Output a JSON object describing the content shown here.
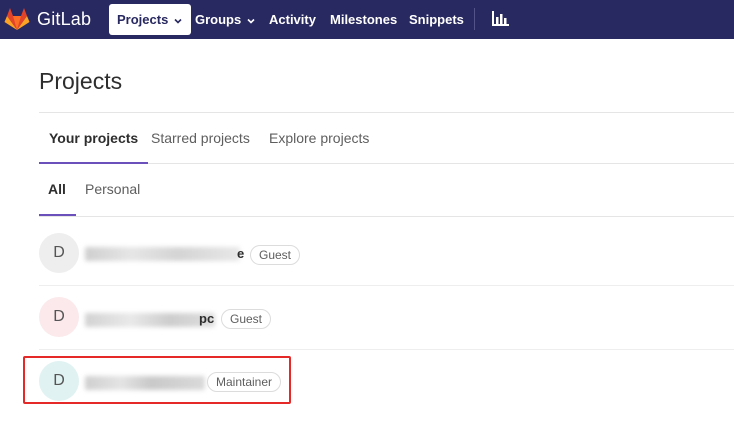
{
  "navbar": {
    "brand": "GitLab",
    "logo_icon": "gitlab-tanuki-icon",
    "items": [
      {
        "label": "Projects",
        "active": true,
        "has_dropdown": true
      },
      {
        "label": "Groups",
        "active": false,
        "has_dropdown": true
      },
      {
        "label": "Activity",
        "active": false,
        "has_dropdown": false
      },
      {
        "label": "Milestones",
        "active": false,
        "has_dropdown": false
      },
      {
        "label": "Snippets",
        "active": false,
        "has_dropdown": false
      }
    ],
    "extra_icon": "chart-bar-icon",
    "background": "#292961"
  },
  "page": {
    "title": "Projects"
  },
  "tabs": [
    {
      "label": "Your projects",
      "active": true
    },
    {
      "label": "Starred projects",
      "active": false
    },
    {
      "label": "Explore projects",
      "active": false
    }
  ],
  "subtabs": [
    {
      "label": "All",
      "active": true
    },
    {
      "label": "Personal",
      "active": false
    }
  ],
  "projects": [
    {
      "avatar_letter": "D",
      "name_visible_suffix": "e",
      "role": "Guest",
      "avatar_color": "#eeeeee"
    },
    {
      "avatar_letter": "D",
      "name_visible_suffix": "pc",
      "role": "Guest",
      "avatar_color": "#fbe9eb"
    },
    {
      "avatar_letter": "D",
      "name_visible_suffix": "",
      "role": "Maintainer",
      "avatar_color": "#e0f2f1",
      "highlighted": true
    }
  ],
  "colors": {
    "accent": "#6b4fbb",
    "highlight": "#e52929"
  }
}
